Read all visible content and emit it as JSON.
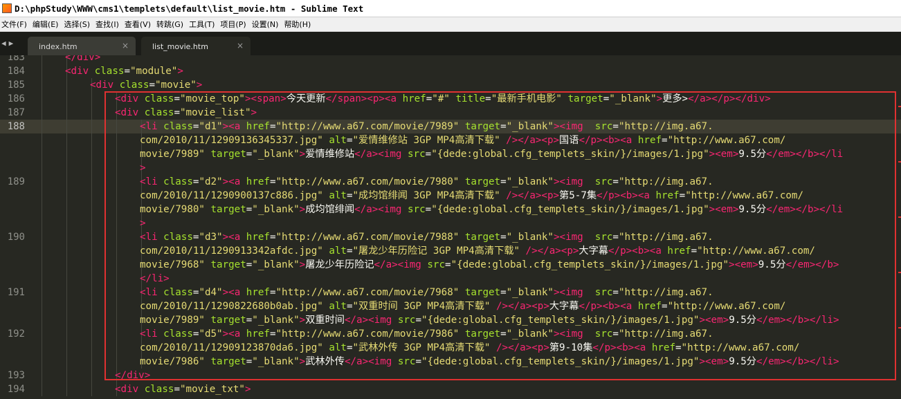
{
  "window": {
    "title": "D:\\phpStudy\\WWW\\cms1\\templets\\default\\list_movie.htm - Sublime Text"
  },
  "menu": [
    "文件(F)",
    "编辑(E)",
    "选择(S)",
    "查找(I)",
    "查看(V)",
    "转跳(G)",
    "工具(T)",
    "项目(P)",
    "设置(N)",
    "帮助(H)"
  ],
  "nav": {
    "back": "◀",
    "forward": "▶"
  },
  "tabs": [
    {
      "label": "index.htm",
      "close": "×"
    },
    {
      "label": "list_movie.htm",
      "close": "×"
    }
  ],
  "line_numbers": [
    "183",
    "184",
    "185",
    "186",
    "187",
    "188",
    "189",
    "190",
    "191",
    "192",
    "193",
    "194"
  ],
  "colors": {
    "tag": "#f92672",
    "attr": "#a6e22e",
    "string": "#e6db74",
    "text": "#f8f8f2",
    "highlight_box": "#e03131"
  },
  "code_rows": [
    [
      [
        "t",
        "</div>"
      ],
      [
        "w",
        ""
      ]
    ],
    [
      [
        "t",
        "<div "
      ],
      [
        "a",
        "class"
      ],
      [
        "w",
        "="
      ],
      [
        "s",
        "\"module\""
      ],
      [
        "t",
        ">"
      ]
    ],
    [
      [
        "t",
        "<div "
      ],
      [
        "a",
        "class"
      ],
      [
        "w",
        "="
      ],
      [
        "s",
        "\"movie\""
      ],
      [
        "t",
        ">"
      ]
    ],
    [
      [
        "t",
        "<div "
      ],
      [
        "a",
        "class"
      ],
      [
        "w",
        "="
      ],
      [
        "s",
        "\"movie_top\""
      ],
      [
        "t",
        "><span>"
      ],
      [
        "w",
        "今天更新"
      ],
      [
        "t",
        "</span><p><a "
      ],
      [
        "a",
        "href"
      ],
      [
        "w",
        "="
      ],
      [
        "s",
        "\"#\" "
      ],
      [
        "a",
        "title"
      ],
      [
        "w",
        "="
      ],
      [
        "s",
        "\"最新手机电影\" "
      ],
      [
        "a",
        "target"
      ],
      [
        "w",
        "="
      ],
      [
        "s",
        "\"_blank\""
      ],
      [
        "t",
        ">"
      ],
      [
        "w",
        "更多>"
      ],
      [
        "t",
        "</a></p></div>"
      ]
    ],
    [
      [
        "t",
        "<div "
      ],
      [
        "a",
        "class"
      ],
      [
        "w",
        "="
      ],
      [
        "s",
        "\"movie_list\""
      ],
      [
        "t",
        ">"
      ]
    ],
    [
      [
        "t",
        "<li "
      ],
      [
        "a",
        "class"
      ],
      [
        "w",
        "="
      ],
      [
        "s",
        "\"d1\""
      ],
      [
        "t",
        "><a "
      ],
      [
        "a",
        "href"
      ],
      [
        "w",
        "="
      ],
      [
        "s",
        "\"http://www.a67.com/movie/7989\" "
      ],
      [
        "a",
        "target"
      ],
      [
        "w",
        "="
      ],
      [
        "s",
        "\"_blank\""
      ],
      [
        "t",
        "><img  "
      ],
      [
        "a",
        "src"
      ],
      [
        "w",
        "="
      ],
      [
        "s",
        "\"http://img.a67."
      ]
    ],
    [
      [
        "s",
        "com/2010/11/12909136345337.jpg\" "
      ],
      [
        "a",
        "alt"
      ],
      [
        "w",
        "="
      ],
      [
        "s",
        "\"爱情维修站 3GP MP4高清下载\" "
      ],
      [
        "t",
        "/></a><p>"
      ],
      [
        "w",
        "国语"
      ],
      [
        "t",
        "</p><b><a "
      ],
      [
        "a",
        "href"
      ],
      [
        "w",
        "="
      ],
      [
        "s",
        "\"http://www.a67.com/"
      ]
    ],
    [
      [
        "s",
        "movie/7989\" "
      ],
      [
        "a",
        "target"
      ],
      [
        "w",
        "="
      ],
      [
        "s",
        "\"_blank\""
      ],
      [
        "t",
        ">"
      ],
      [
        "w",
        "爱情维修站"
      ],
      [
        "t",
        "</a><img "
      ],
      [
        "a",
        "src"
      ],
      [
        "w",
        "="
      ],
      [
        "s",
        "\"{dede:global.cfg_templets_skin/}/images/1.jpg\""
      ],
      [
        "t",
        "><em>"
      ],
      [
        "w",
        "9.5分"
      ],
      [
        "t",
        "</em></b></li"
      ]
    ],
    [
      [
        "t",
        ">"
      ]
    ],
    [
      [
        "t",
        "<li "
      ],
      [
        "a",
        "class"
      ],
      [
        "w",
        "="
      ],
      [
        "s",
        "\"d2\""
      ],
      [
        "t",
        "><a "
      ],
      [
        "a",
        "href"
      ],
      [
        "w",
        "="
      ],
      [
        "s",
        "\"http://www.a67.com/movie/7980\" "
      ],
      [
        "a",
        "target"
      ],
      [
        "w",
        "="
      ],
      [
        "s",
        "\"_blank\""
      ],
      [
        "t",
        "><img  "
      ],
      [
        "a",
        "src"
      ],
      [
        "w",
        "="
      ],
      [
        "s",
        "\"http://img.a67."
      ]
    ],
    [
      [
        "s",
        "com/2010/11/1290900137c886.jpg\" "
      ],
      [
        "a",
        "alt"
      ],
      [
        "w",
        "="
      ],
      [
        "s",
        "\"成均馆绯闻 3GP MP4高清下载\" "
      ],
      [
        "t",
        "/></a><p>"
      ],
      [
        "w",
        "第5-7集"
      ],
      [
        "t",
        "</p><b><a "
      ],
      [
        "a",
        "href"
      ],
      [
        "w",
        "="
      ],
      [
        "s",
        "\"http://www.a67.com/"
      ]
    ],
    [
      [
        "s",
        "movie/7980\" "
      ],
      [
        "a",
        "target"
      ],
      [
        "w",
        "="
      ],
      [
        "s",
        "\"_blank\""
      ],
      [
        "t",
        ">"
      ],
      [
        "w",
        "成均馆绯闻"
      ],
      [
        "t",
        "</a><img "
      ],
      [
        "a",
        "src"
      ],
      [
        "w",
        "="
      ],
      [
        "s",
        "\"{dede:global.cfg_templets_skin/}/images/1.jpg\""
      ],
      [
        "t",
        "><em>"
      ],
      [
        "w",
        "9.5分"
      ],
      [
        "t",
        "</em></b></li"
      ]
    ],
    [
      [
        "t",
        ">"
      ]
    ],
    [
      [
        "t",
        "<li "
      ],
      [
        "a",
        "class"
      ],
      [
        "w",
        "="
      ],
      [
        "s",
        "\"d3\""
      ],
      [
        "t",
        "><a "
      ],
      [
        "a",
        "href"
      ],
      [
        "w",
        "="
      ],
      [
        "s",
        "\"http://www.a67.com/movie/7988\" "
      ],
      [
        "a",
        "target"
      ],
      [
        "w",
        "="
      ],
      [
        "s",
        "\"_blank\""
      ],
      [
        "t",
        "><img  "
      ],
      [
        "a",
        "src"
      ],
      [
        "w",
        "="
      ],
      [
        "s",
        "\"http://img.a67."
      ]
    ],
    [
      [
        "s",
        "com/2010/11/1290913342afdc.jpg\" "
      ],
      [
        "a",
        "alt"
      ],
      [
        "w",
        "="
      ],
      [
        "s",
        "\"屠龙少年历险记 3GP MP4高清下载\" "
      ],
      [
        "t",
        "/></a><p>"
      ],
      [
        "w",
        "大字幕"
      ],
      [
        "t",
        "</p><b><a "
      ],
      [
        "a",
        "href"
      ],
      [
        "w",
        "="
      ],
      [
        "s",
        "\"http://www.a67.com/"
      ]
    ],
    [
      [
        "s",
        "movie/7968\" "
      ],
      [
        "a",
        "target"
      ],
      [
        "w",
        "="
      ],
      [
        "s",
        "\"_blank\""
      ],
      [
        "t",
        ">"
      ],
      [
        "w",
        "屠龙少年历险记"
      ],
      [
        "t",
        "</a><img "
      ],
      [
        "a",
        "src"
      ],
      [
        "w",
        "="
      ],
      [
        "s",
        "\"{dede:global.cfg_templets_skin/}/images/1.jpg\""
      ],
      [
        "t",
        "><em>"
      ],
      [
        "w",
        "9.5分"
      ],
      [
        "t",
        "</em></b>"
      ]
    ],
    [
      [
        "t",
        "</li>"
      ]
    ],
    [
      [
        "t",
        "<li "
      ],
      [
        "a",
        "class"
      ],
      [
        "w",
        "="
      ],
      [
        "s",
        "\"d4\""
      ],
      [
        "t",
        "><a "
      ],
      [
        "a",
        "href"
      ],
      [
        "w",
        "="
      ],
      [
        "s",
        "\"http://www.a67.com/movie/7968\" "
      ],
      [
        "a",
        "target"
      ],
      [
        "w",
        "="
      ],
      [
        "s",
        "\"_blank\""
      ],
      [
        "t",
        "><img  "
      ],
      [
        "a",
        "src"
      ],
      [
        "w",
        "="
      ],
      [
        "s",
        "\"http://img.a67."
      ]
    ],
    [
      [
        "s",
        "com/2010/11/1290822680b0ab.jpg\" "
      ],
      [
        "a",
        "alt"
      ],
      [
        "w",
        "="
      ],
      [
        "s",
        "\"双重时间 3GP MP4高清下载\" "
      ],
      [
        "t",
        "/></a><p>"
      ],
      [
        "w",
        "大字幕"
      ],
      [
        "t",
        "</p><b><a "
      ],
      [
        "a",
        "href"
      ],
      [
        "w",
        "="
      ],
      [
        "s",
        "\"http://www.a67.com/"
      ]
    ],
    [
      [
        "s",
        "movie/7989\" "
      ],
      [
        "a",
        "target"
      ],
      [
        "w",
        "="
      ],
      [
        "s",
        "\"_blank\""
      ],
      [
        "t",
        ">"
      ],
      [
        "w",
        "双重时间"
      ],
      [
        "t",
        "</a><img "
      ],
      [
        "a",
        "src"
      ],
      [
        "w",
        "="
      ],
      [
        "s",
        "\"{dede:global.cfg_templets_skin/}/images/1.jpg\""
      ],
      [
        "t",
        "><em>"
      ],
      [
        "w",
        "9.5分"
      ],
      [
        "t",
        "</em></b></li>"
      ]
    ],
    [
      [
        "t",
        "<li "
      ],
      [
        "a",
        "class"
      ],
      [
        "w",
        "="
      ],
      [
        "s",
        "\"d5\""
      ],
      [
        "t",
        "><a "
      ],
      [
        "a",
        "href"
      ],
      [
        "w",
        "="
      ],
      [
        "s",
        "\"http://www.a67.com/movie/7986\" "
      ],
      [
        "a",
        "target"
      ],
      [
        "w",
        "="
      ],
      [
        "s",
        "\"_blank\""
      ],
      [
        "t",
        "><img  "
      ],
      [
        "a",
        "src"
      ],
      [
        "w",
        "="
      ],
      [
        "s",
        "\"http://img.a67."
      ]
    ],
    [
      [
        "s",
        "com/2010/11/12909123870da6.jpg\" "
      ],
      [
        "a",
        "alt"
      ],
      [
        "w",
        "="
      ],
      [
        "s",
        "\"武林外传 3GP MP4高清下载\" "
      ],
      [
        "t",
        "/></a><p>"
      ],
      [
        "w",
        "第9-10集"
      ],
      [
        "t",
        "</p><b><a "
      ],
      [
        "a",
        "href"
      ],
      [
        "w",
        "="
      ],
      [
        "s",
        "\"http://www.a67.com/"
      ]
    ],
    [
      [
        "s",
        "movie/7986\" "
      ],
      [
        "a",
        "target"
      ],
      [
        "w",
        "="
      ],
      [
        "s",
        "\"_blank\""
      ],
      [
        "t",
        ">"
      ],
      [
        "w",
        "武林外传"
      ],
      [
        "t",
        "</a><img "
      ],
      [
        "a",
        "src"
      ],
      [
        "w",
        "="
      ],
      [
        "s",
        "\"{dede:global.cfg_templets_skin/}/images/1.jpg\""
      ],
      [
        "t",
        "><em>"
      ],
      [
        "w",
        "9.5分"
      ],
      [
        "t",
        "</em></b></li>"
      ]
    ],
    [
      [
        "t",
        "</div>"
      ]
    ],
    [
      [
        "t",
        "<div "
      ],
      [
        "a",
        "class"
      ],
      [
        "w",
        "="
      ],
      [
        "s",
        "\"movie_txt\""
      ],
      [
        "t",
        ">"
      ]
    ]
  ]
}
